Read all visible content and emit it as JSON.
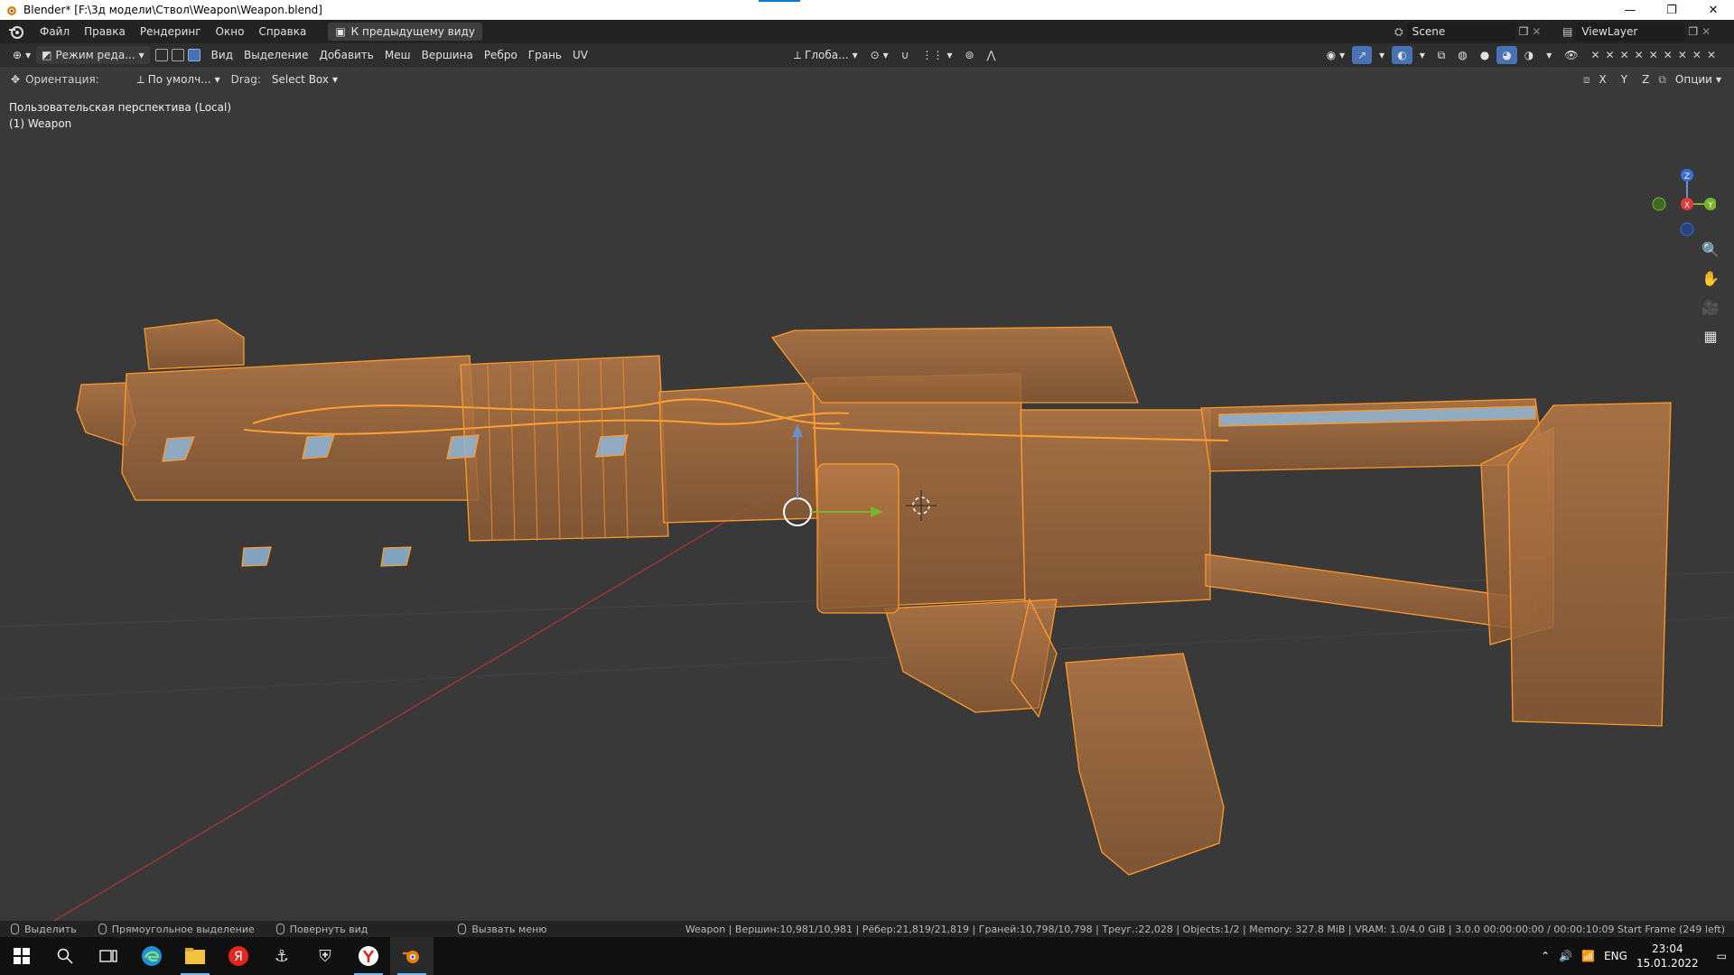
{
  "window": {
    "title": "Blender* [F:\\3д модели\\Ствол\\Weapon\\Weapon.blend]",
    "minimize": "—",
    "maximize": "❐",
    "close": "✕"
  },
  "topbar": {
    "menu": [
      "Файл",
      "Правка",
      "Рендеринг",
      "Окно",
      "Справка"
    ],
    "back_button": "К предыдущему виду",
    "scene_label": "Scene",
    "viewlayer_label": "ViewLayer"
  },
  "header3d": {
    "mode": "Режим реда...",
    "menu": [
      "Вид",
      "Выделение",
      "Добавить",
      "Меш",
      "Вершина",
      "Ребро",
      "Грань",
      "UV"
    ],
    "transform_orientation": "Глоба...",
    "options": "Опции",
    "axes": [
      "X",
      "Y",
      "Z"
    ]
  },
  "tool_settings": {
    "orientation_label": "Ориентация:",
    "orientation_value": "По умолч...",
    "drag_label": "Drag:",
    "drag_value": "Select Box"
  },
  "viewport": {
    "perspective": "Пользовательская перспектива (Local)",
    "object": "(1) Weapon",
    "gizmo_axes": {
      "z": "Z",
      "y": "Y",
      "x": "X"
    }
  },
  "statusbar": {
    "select": "Выделить",
    "box_select": "Прямоугольное выделение",
    "rotate_view": "Повернуть вид",
    "call_menu": "Вызвать меню",
    "stats": "Weapon | Вершин:10,981/10,981 | Рёбер:21,819/21,819 | Граней:10,798/10,798 | Треуг.:22,028 | Objects:1/2 | Memory: 327.8 MiB | VRAM: 1.0/4.0 GiB | 3.0.0  00:00:00:00 / 00:00:10:09  Start Frame (249 left)"
  },
  "taskbar": {
    "language": "ENG",
    "time": "23:04",
    "date": "15.01.2022"
  },
  "colors": {
    "accent_blue": "#4772b3",
    "mesh_orange": "#d4822e",
    "viewport_bg": "#393939"
  }
}
